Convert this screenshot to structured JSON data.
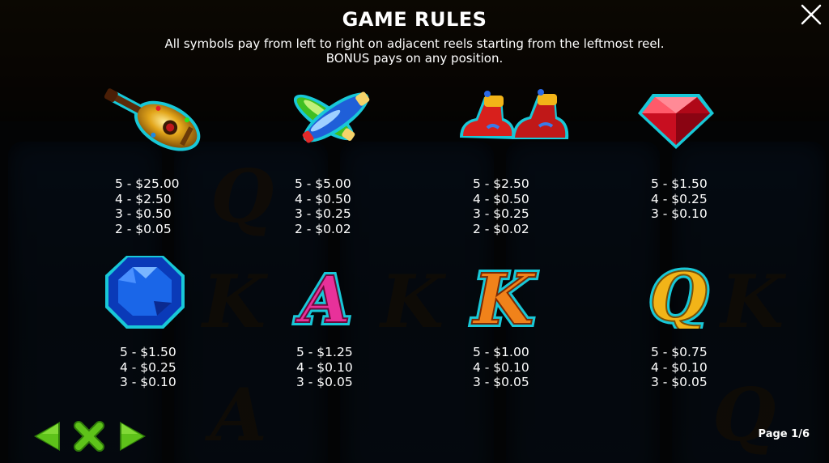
{
  "title": "GAME RULES",
  "description_line1": "All symbols pay from left to right on adjacent reels starting from the leftmost reel.",
  "description_line2": "BONUS pays on any position.",
  "page_indicator": "Page 1/6",
  "symbols": [
    {
      "icon": "lute-icon",
      "pays": [
        "5 - $25.00",
        "4 - $2.50",
        "3 - $0.50",
        "2 - $0.05"
      ]
    },
    {
      "icon": "juggling-pins-icon",
      "pays": [
        "5 - $5.00",
        "4 - $0.50",
        "3 - $0.25",
        "2 - $0.02"
      ]
    },
    {
      "icon": "jester-shoes-icon",
      "pays": [
        "5 - $2.50",
        "4 - $0.50",
        "3 - $0.25",
        "2 - $0.02"
      ]
    },
    {
      "icon": "ruby-gem-icon",
      "pays": [
        "5 - $1.50",
        "4 - $0.25",
        "3 - $0.10"
      ]
    },
    {
      "icon": "sapphire-gem-icon",
      "pays": [
        "5 - $1.50",
        "4 - $0.25",
        "3 - $0.10"
      ]
    },
    {
      "icon": "letter-a-icon",
      "pays": [
        "5 - $1.25",
        "4 - $0.10",
        "3 - $0.05"
      ]
    },
    {
      "icon": "letter-k-icon",
      "pays": [
        "5 - $1.00",
        "4 - $0.10",
        "3 - $0.05"
      ]
    },
    {
      "icon": "letter-q-icon",
      "pays": [
        "5 - $0.75",
        "4 - $0.10",
        "3 - $0.05"
      ]
    }
  ],
  "colors": {
    "nav_green": "#5ec21a",
    "nav_green_dark": "#2f7a0a",
    "ruby": "#e8122a",
    "sapphire": "#1a66e8",
    "gold": "#f2b418",
    "letter_a": "#e8319a",
    "outline_cyan": "#39d3e6"
  }
}
